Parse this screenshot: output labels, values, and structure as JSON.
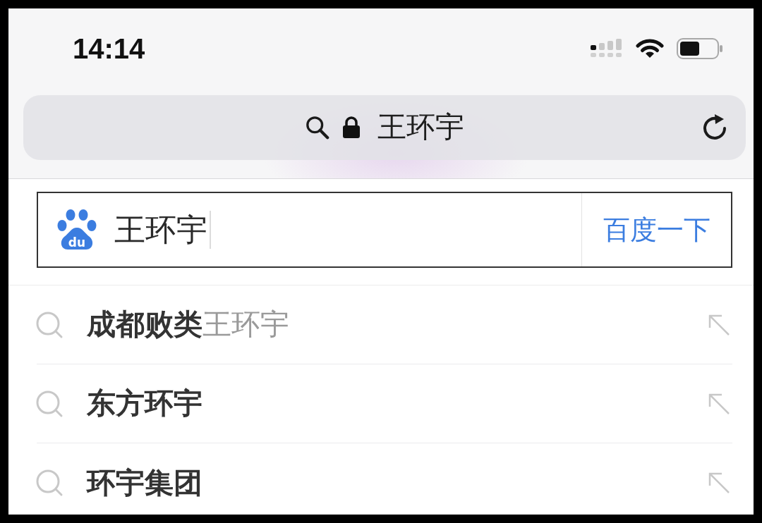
{
  "status_bar": {
    "time": "14:14"
  },
  "address_bar": {
    "text": "王环宇"
  },
  "search_box": {
    "logo_text": "du",
    "value": "王环宇",
    "focused": true,
    "button": "百度一下"
  },
  "suggestions": [
    {
      "text": "成都败类",
      "match": "王环宇"
    },
    {
      "text": "东方环宇"
    },
    {
      "text": "环宇集团"
    }
  ]
}
